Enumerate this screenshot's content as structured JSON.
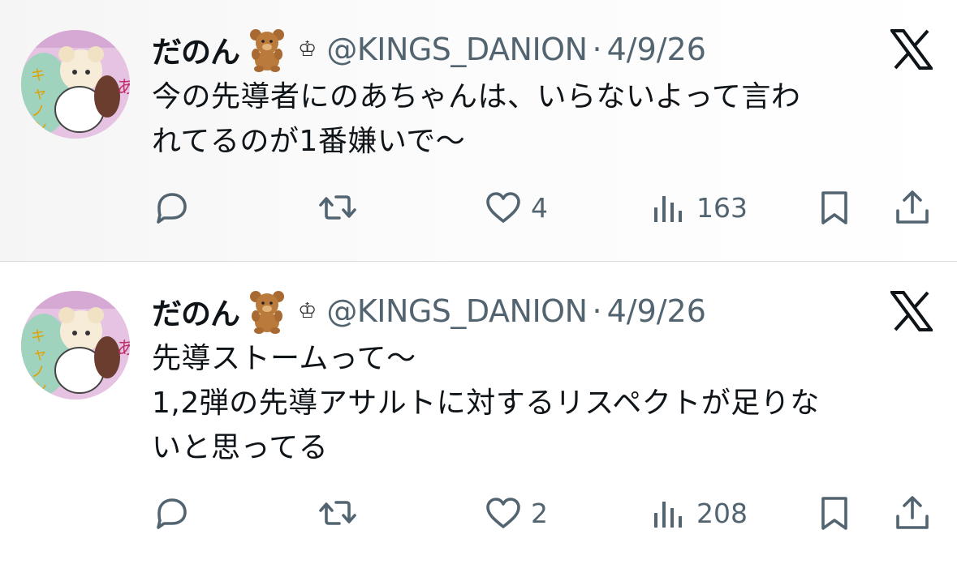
{
  "tweets": [
    {
      "author": {
        "name": "だのん",
        "handle": "@KINGS_DANION",
        "date": "4/9/26"
      },
      "separator": "·",
      "crown": "♔",
      "text_lines": [
        "今の先導者にのあちゃんは、いらないよって言わ",
        "れてるのが1番嫌いで〜"
      ],
      "stats": {
        "replies": "",
        "reposts": "",
        "likes": "4",
        "views": "163"
      }
    },
    {
      "author": {
        "name": "だのん",
        "handle": "@KINGS_DANION",
        "date": "4/9/26"
      },
      "separator": "·",
      "crown": "♔",
      "text_lines": [
        "先導ストームって〜",
        "1,2弾の先導アサルトに対するリスペクトが足りな",
        "いと思ってる"
      ],
      "stats": {
        "replies": "",
        "reposts": "",
        "likes": "2",
        "views": "208"
      }
    }
  ],
  "icons": {
    "reply": "speech-bubble-icon",
    "repost": "repost-arrows-icon",
    "like": "heart-icon",
    "views": "bar-chart-icon",
    "bookmark": "bookmark-icon",
    "share": "share-icon",
    "brand": "x-logo-icon",
    "emoji": "teddy-bear-emoji"
  },
  "colors": {
    "secondary_text": "#536471",
    "primary_text": "#0f1419",
    "divider": "#dcdcdc"
  }
}
